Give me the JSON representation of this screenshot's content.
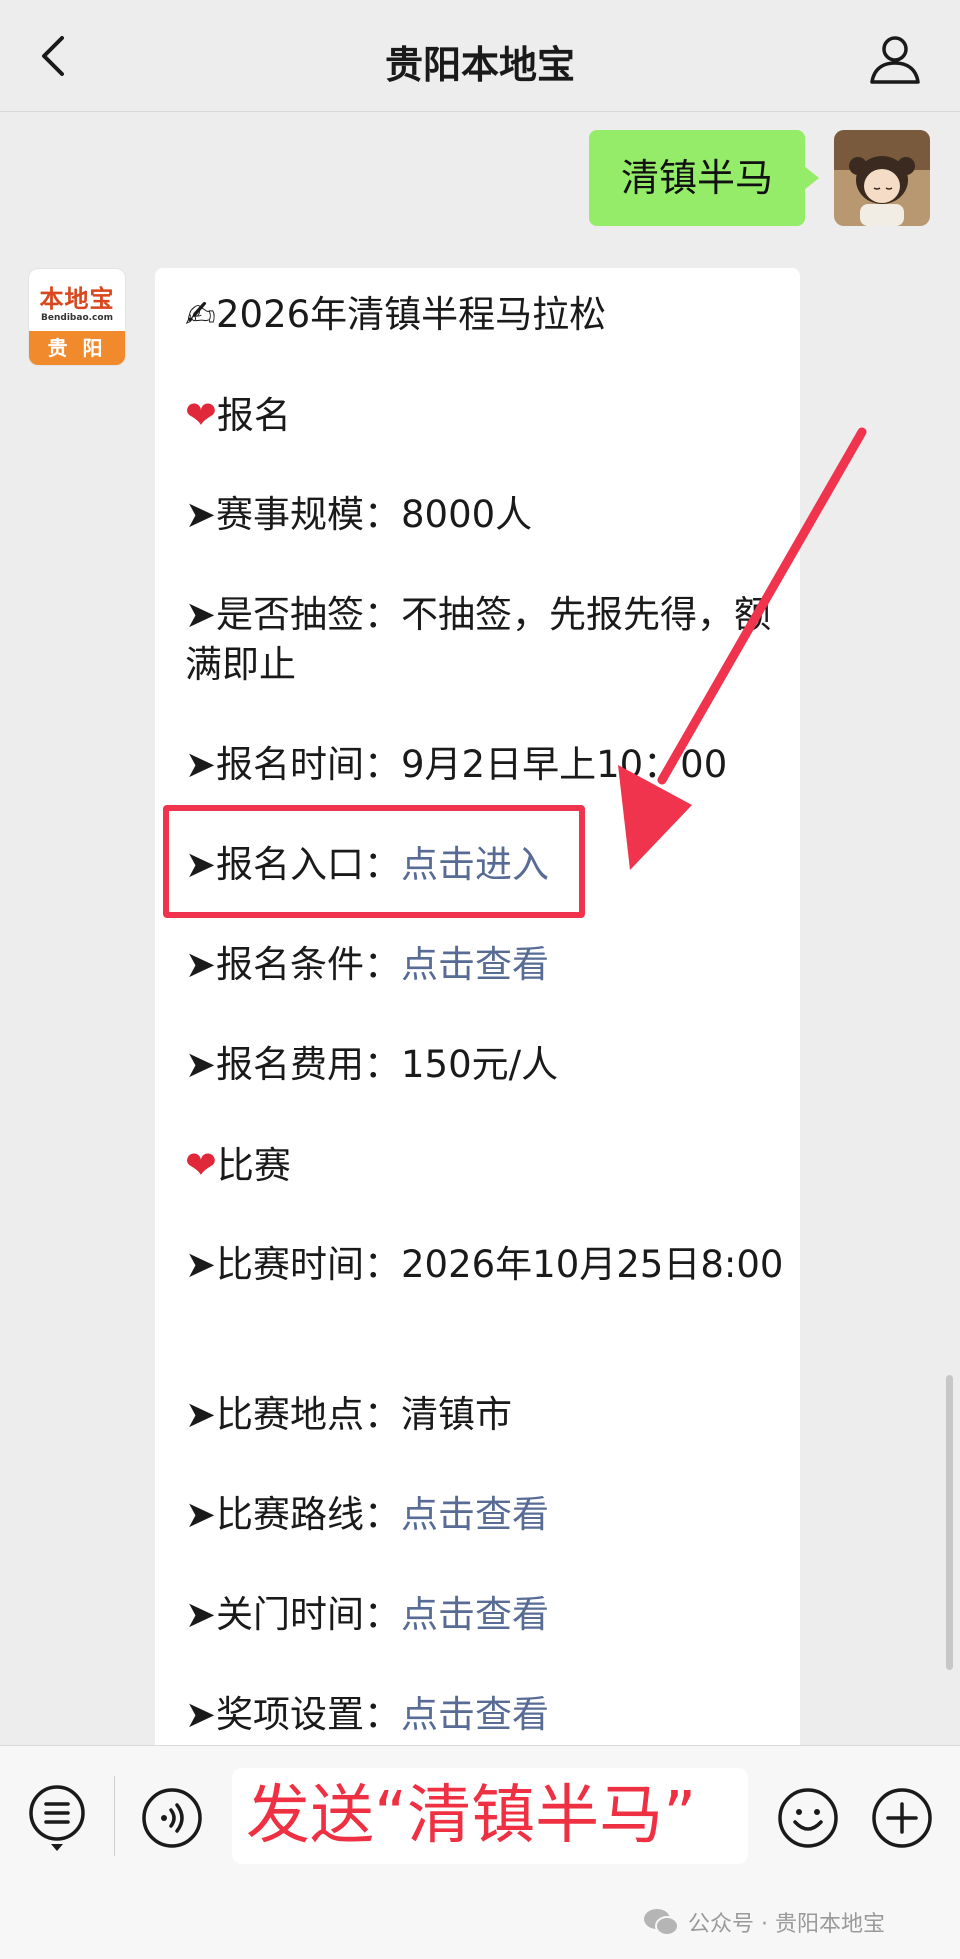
{
  "header": {
    "title": "贵阳本地宝"
  },
  "chat": {
    "outgoing_message": "清镇半马",
    "bot_logo": {
      "top_text": "本地宝",
      "small_text": "Bendibao.com",
      "city_text": "贵 阳"
    },
    "incoming": {
      "title": "✍2026年清镇半程马拉松",
      "section1": "报名",
      "scale_label": "➤赛事规模：",
      "scale_value": "8000人",
      "lottery_label": "➤是否抽签：",
      "lottery_value": "不抽签，先报先得，额满即止",
      "reg_time_label": "➤报名时间：",
      "reg_time_value": "9月2日早上10：00",
      "reg_entry_label": "➤报名入口：",
      "reg_entry_link": "点击进入",
      "reg_cond_label": "➤报名条件：",
      "reg_cond_link": "点击查看",
      "reg_fee_label": "➤报名费用：",
      "reg_fee_value": "150元/人",
      "section2": "比赛",
      "race_time_label": "➤比赛时间：",
      "race_time_value": "2026年10月25日8:00",
      "race_place_label": "➤比赛地点：",
      "race_place_value": "清镇市",
      "route_label": "➤比赛路线：",
      "route_link": "点击查看",
      "close_label": "➤关门时间：",
      "close_link": "点击查看",
      "award_label": "➤奖项设置：",
      "award_link": "点击查看"
    }
  },
  "input": {
    "text": "发送“清镇半马”"
  },
  "watermark": {
    "text": "公众号 · 贵阳本地宝"
  },
  "colors": {
    "accent_green": "#95ec69",
    "link": "#576b95",
    "highlight_red": "#f0344e"
  }
}
